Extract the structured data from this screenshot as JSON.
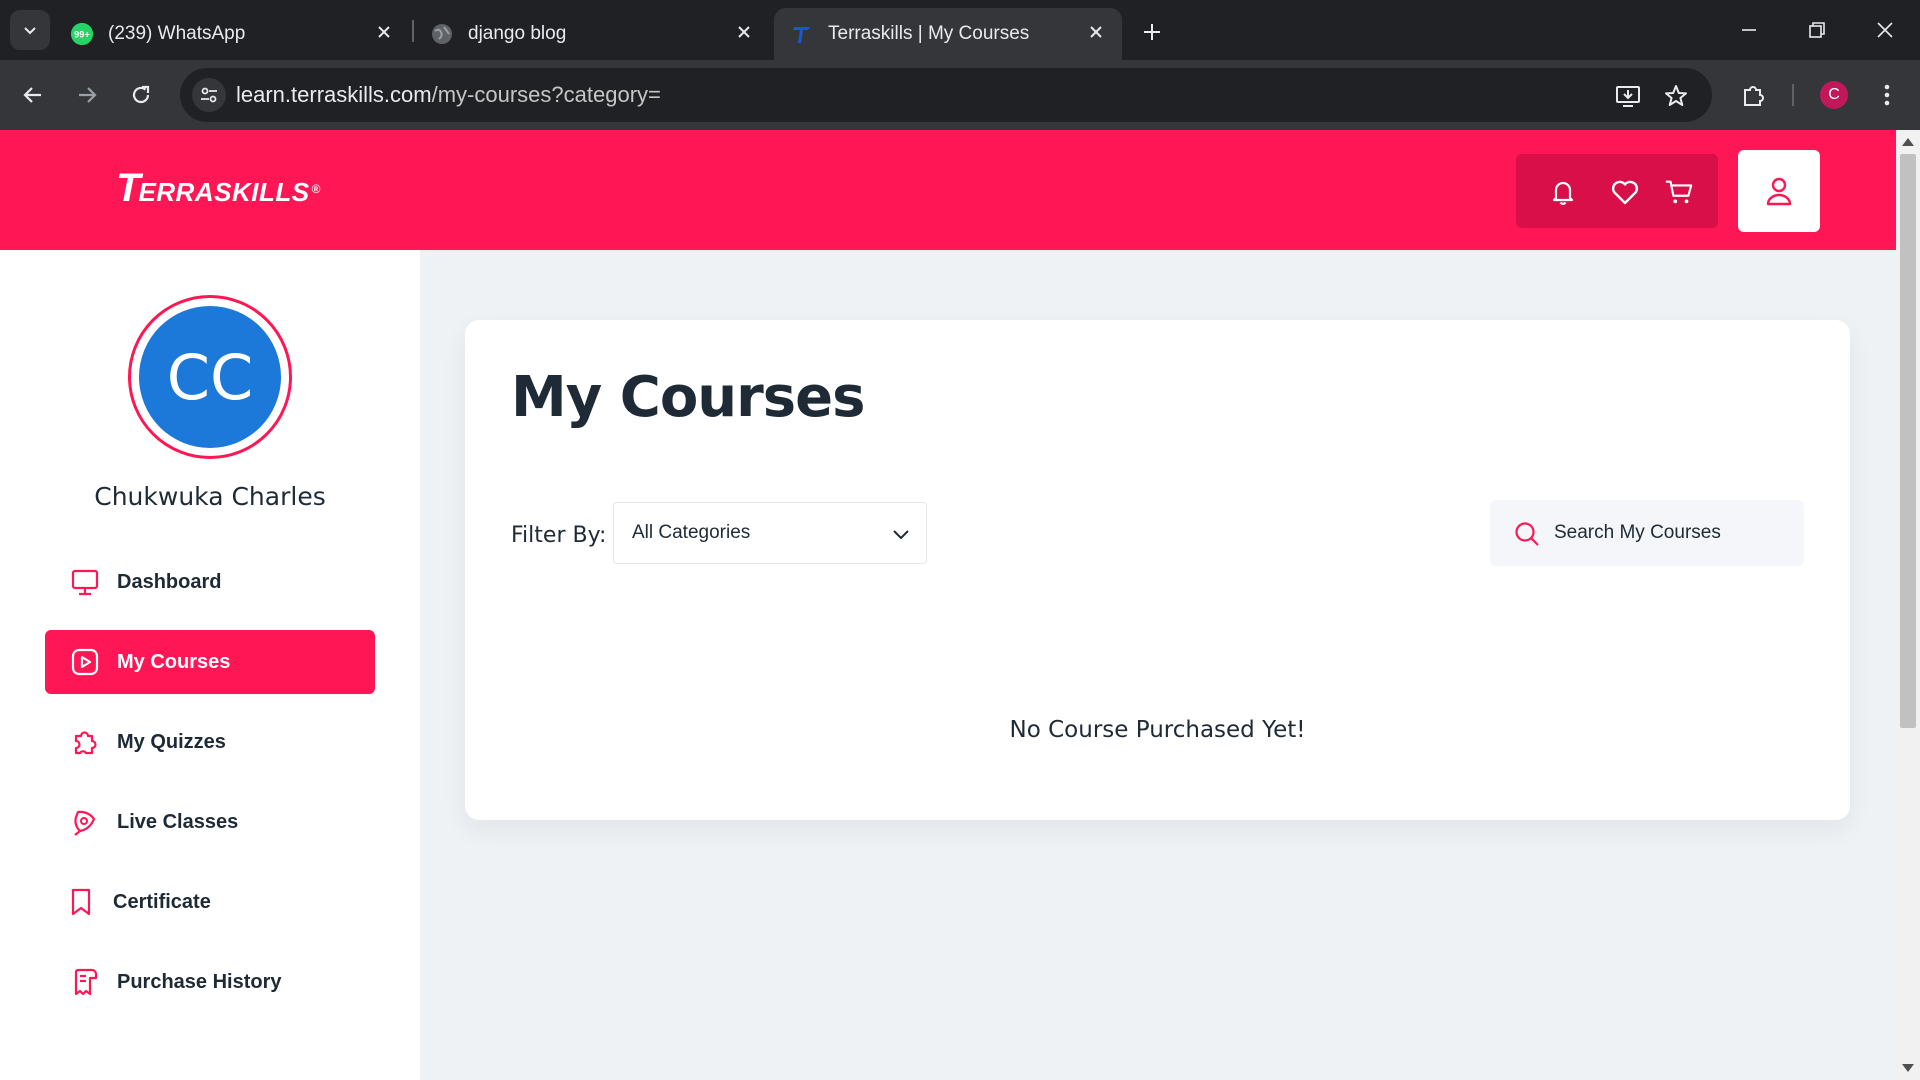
{
  "browser": {
    "tabs": [
      {
        "title": "(239) WhatsApp",
        "badge": "99+",
        "icon": "whatsapp-icon",
        "active": false
      },
      {
        "title": "django blog",
        "icon": "globe-icon",
        "active": false
      },
      {
        "title": "Terraskills | My Courses",
        "icon": "terraskills-favicon",
        "active": true
      }
    ],
    "url_host": "learn.terraskills.com",
    "url_path": "/my-courses?category=",
    "profile_initial": "C"
  },
  "header": {
    "logo_initial": "T",
    "logo_text": "ERRASKILLS",
    "logo_mark": "®",
    "icons": [
      "bell-icon",
      "heart-icon",
      "cart-icon",
      "user-icon"
    ]
  },
  "sidebar": {
    "avatar_initials": "CC",
    "user_name": "Chukwuka Charles",
    "items": [
      {
        "label": "Dashboard",
        "icon": "monitor-icon",
        "active": false
      },
      {
        "label": "My Courses",
        "icon": "play-square-icon",
        "active": true
      },
      {
        "label": "My Quizzes",
        "icon": "puzzle-icon",
        "active": false
      },
      {
        "label": "Live Classes",
        "icon": "broadcast-icon",
        "active": false
      },
      {
        "label": "Certificate",
        "icon": "bookmark-icon",
        "active": false
      },
      {
        "label": "Purchase History",
        "icon": "receipt-icon",
        "active": false
      }
    ]
  },
  "main": {
    "title": "My Courses",
    "filter_label": "Filter By:",
    "filter_value": "All Categories",
    "search_placeholder": "Search My Courses",
    "empty_message": "No Course Purchased Yet!"
  },
  "colors": {
    "brand": "#ff1654",
    "brand_dark": "#d80f48",
    "avatar": "#1c79d9",
    "text": "#1e2a36",
    "page_bg": "#eef2f5"
  }
}
